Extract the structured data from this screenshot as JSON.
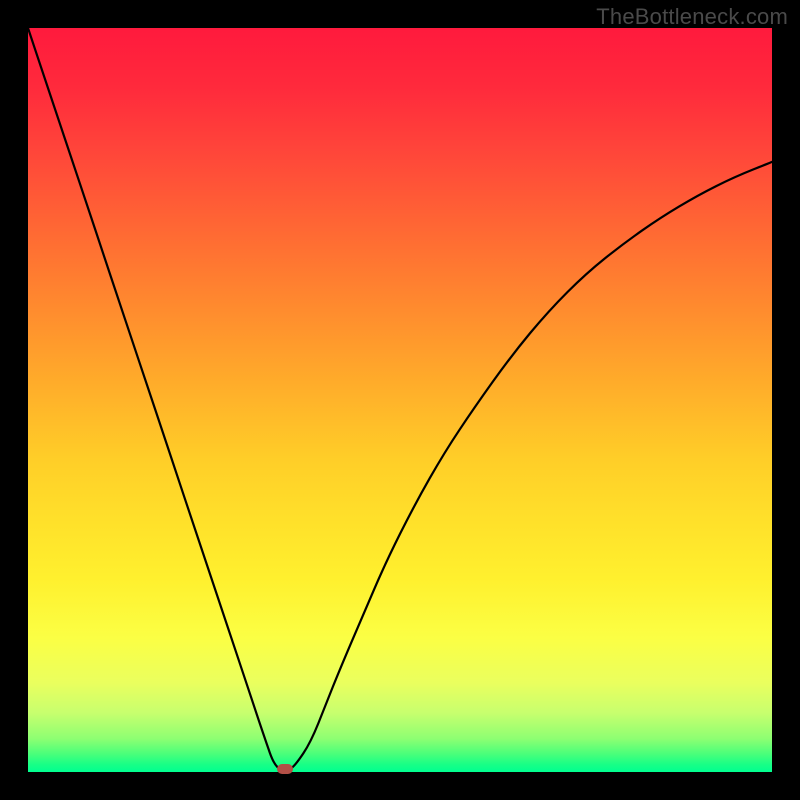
{
  "watermark": "TheBottleneck.com",
  "colors": {
    "frame": "#000000",
    "curve": "#000000",
    "marker": "#b24f46"
  },
  "chart_data": {
    "type": "line",
    "title": "",
    "xlabel": "",
    "ylabel": "",
    "xlim": [
      0,
      100
    ],
    "ylim": [
      0,
      100
    ],
    "grid": false,
    "legend": false,
    "series": [
      {
        "name": "bottleneck-curve",
        "x": [
          0,
          2,
          4,
          6,
          8,
          10,
          12,
          14,
          16,
          18,
          20,
          22,
          24,
          26,
          28,
          30,
          32,
          33,
          34,
          35,
          36,
          38,
          40,
          42,
          45,
          48,
          52,
          56,
          60,
          65,
          70,
          75,
          80,
          85,
          90,
          95,
          100
        ],
        "y": [
          100,
          94,
          88,
          82,
          76,
          70,
          64,
          58,
          52,
          46,
          40,
          34,
          28,
          22,
          16,
          10,
          4,
          1.2,
          0.2,
          0.2,
          1.0,
          4,
          9,
          14,
          21,
          28,
          36,
          43,
          49,
          56,
          62,
          67,
          71,
          74.5,
          77.5,
          80,
          82
        ]
      }
    ],
    "marker": {
      "x": 34.5,
      "y": 0.4,
      "label": "optimal-point"
    },
    "background_gradient": {
      "top": "#ff1a3d",
      "mid1": "#ff8c2e",
      "mid2": "#fff02e",
      "bottom": "#00ff90"
    }
  }
}
